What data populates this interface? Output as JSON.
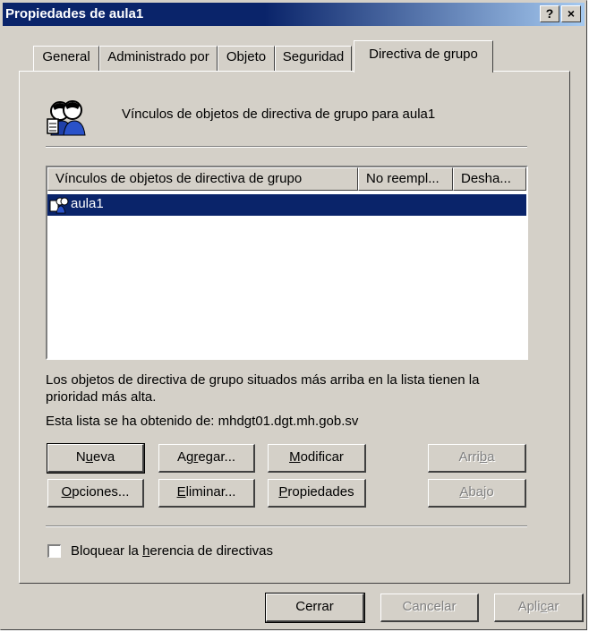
{
  "window": {
    "title": "Propiedades de aula1",
    "help_label": "?",
    "close_label": "×"
  },
  "tabs": [
    {
      "label": "General"
    },
    {
      "label": "Administrado por"
    },
    {
      "label": "Objeto"
    },
    {
      "label": "Seguridad"
    },
    {
      "label": "Directiva de grupo",
      "active": true
    }
  ],
  "header": {
    "description": "Vínculos de objetos de directiva de grupo para aula1"
  },
  "list": {
    "columns": [
      "Vínculos de objetos de directiva de grupo",
      "No reempl...",
      "Desha..."
    ],
    "rows": [
      {
        "name": "aula1",
        "selected": true
      }
    ]
  },
  "info": {
    "priority_text_line1": "Los objetos de directiva de grupo situados más arriba en la lista tienen la",
    "priority_text_line2": "prioridad más alta.",
    "source_text": "Esta lista se ha obtenido de: mhdgt01.dgt.mh.gob.sv"
  },
  "buttons": {
    "new": {
      "pre": "N",
      "u": "u",
      "post": "eva"
    },
    "add": {
      "pre": "Ag",
      "u": "r",
      "post": "egar..."
    },
    "edit": {
      "pre": "",
      "u": "M",
      "post": "odificar"
    },
    "up": {
      "pre": "Arri",
      "u": "b",
      "post": "a"
    },
    "options": {
      "pre": "",
      "u": "O",
      "post": "pciones..."
    },
    "delete": {
      "pre": "",
      "u": "E",
      "post": "liminar..."
    },
    "properties": {
      "pre": "",
      "u": "P",
      "post": "ropiedades"
    },
    "down": {
      "pre": "",
      "u": "A",
      "post": "bajo"
    }
  },
  "checkbox": {
    "pre": "Bloquear la ",
    "u": "h",
    "post": "erencia de directivas",
    "checked": false
  },
  "footer": {
    "close": "Cerrar",
    "cancel": "Cancelar",
    "apply_pre": "Apli",
    "apply_u": "c",
    "apply_post": "ar"
  }
}
